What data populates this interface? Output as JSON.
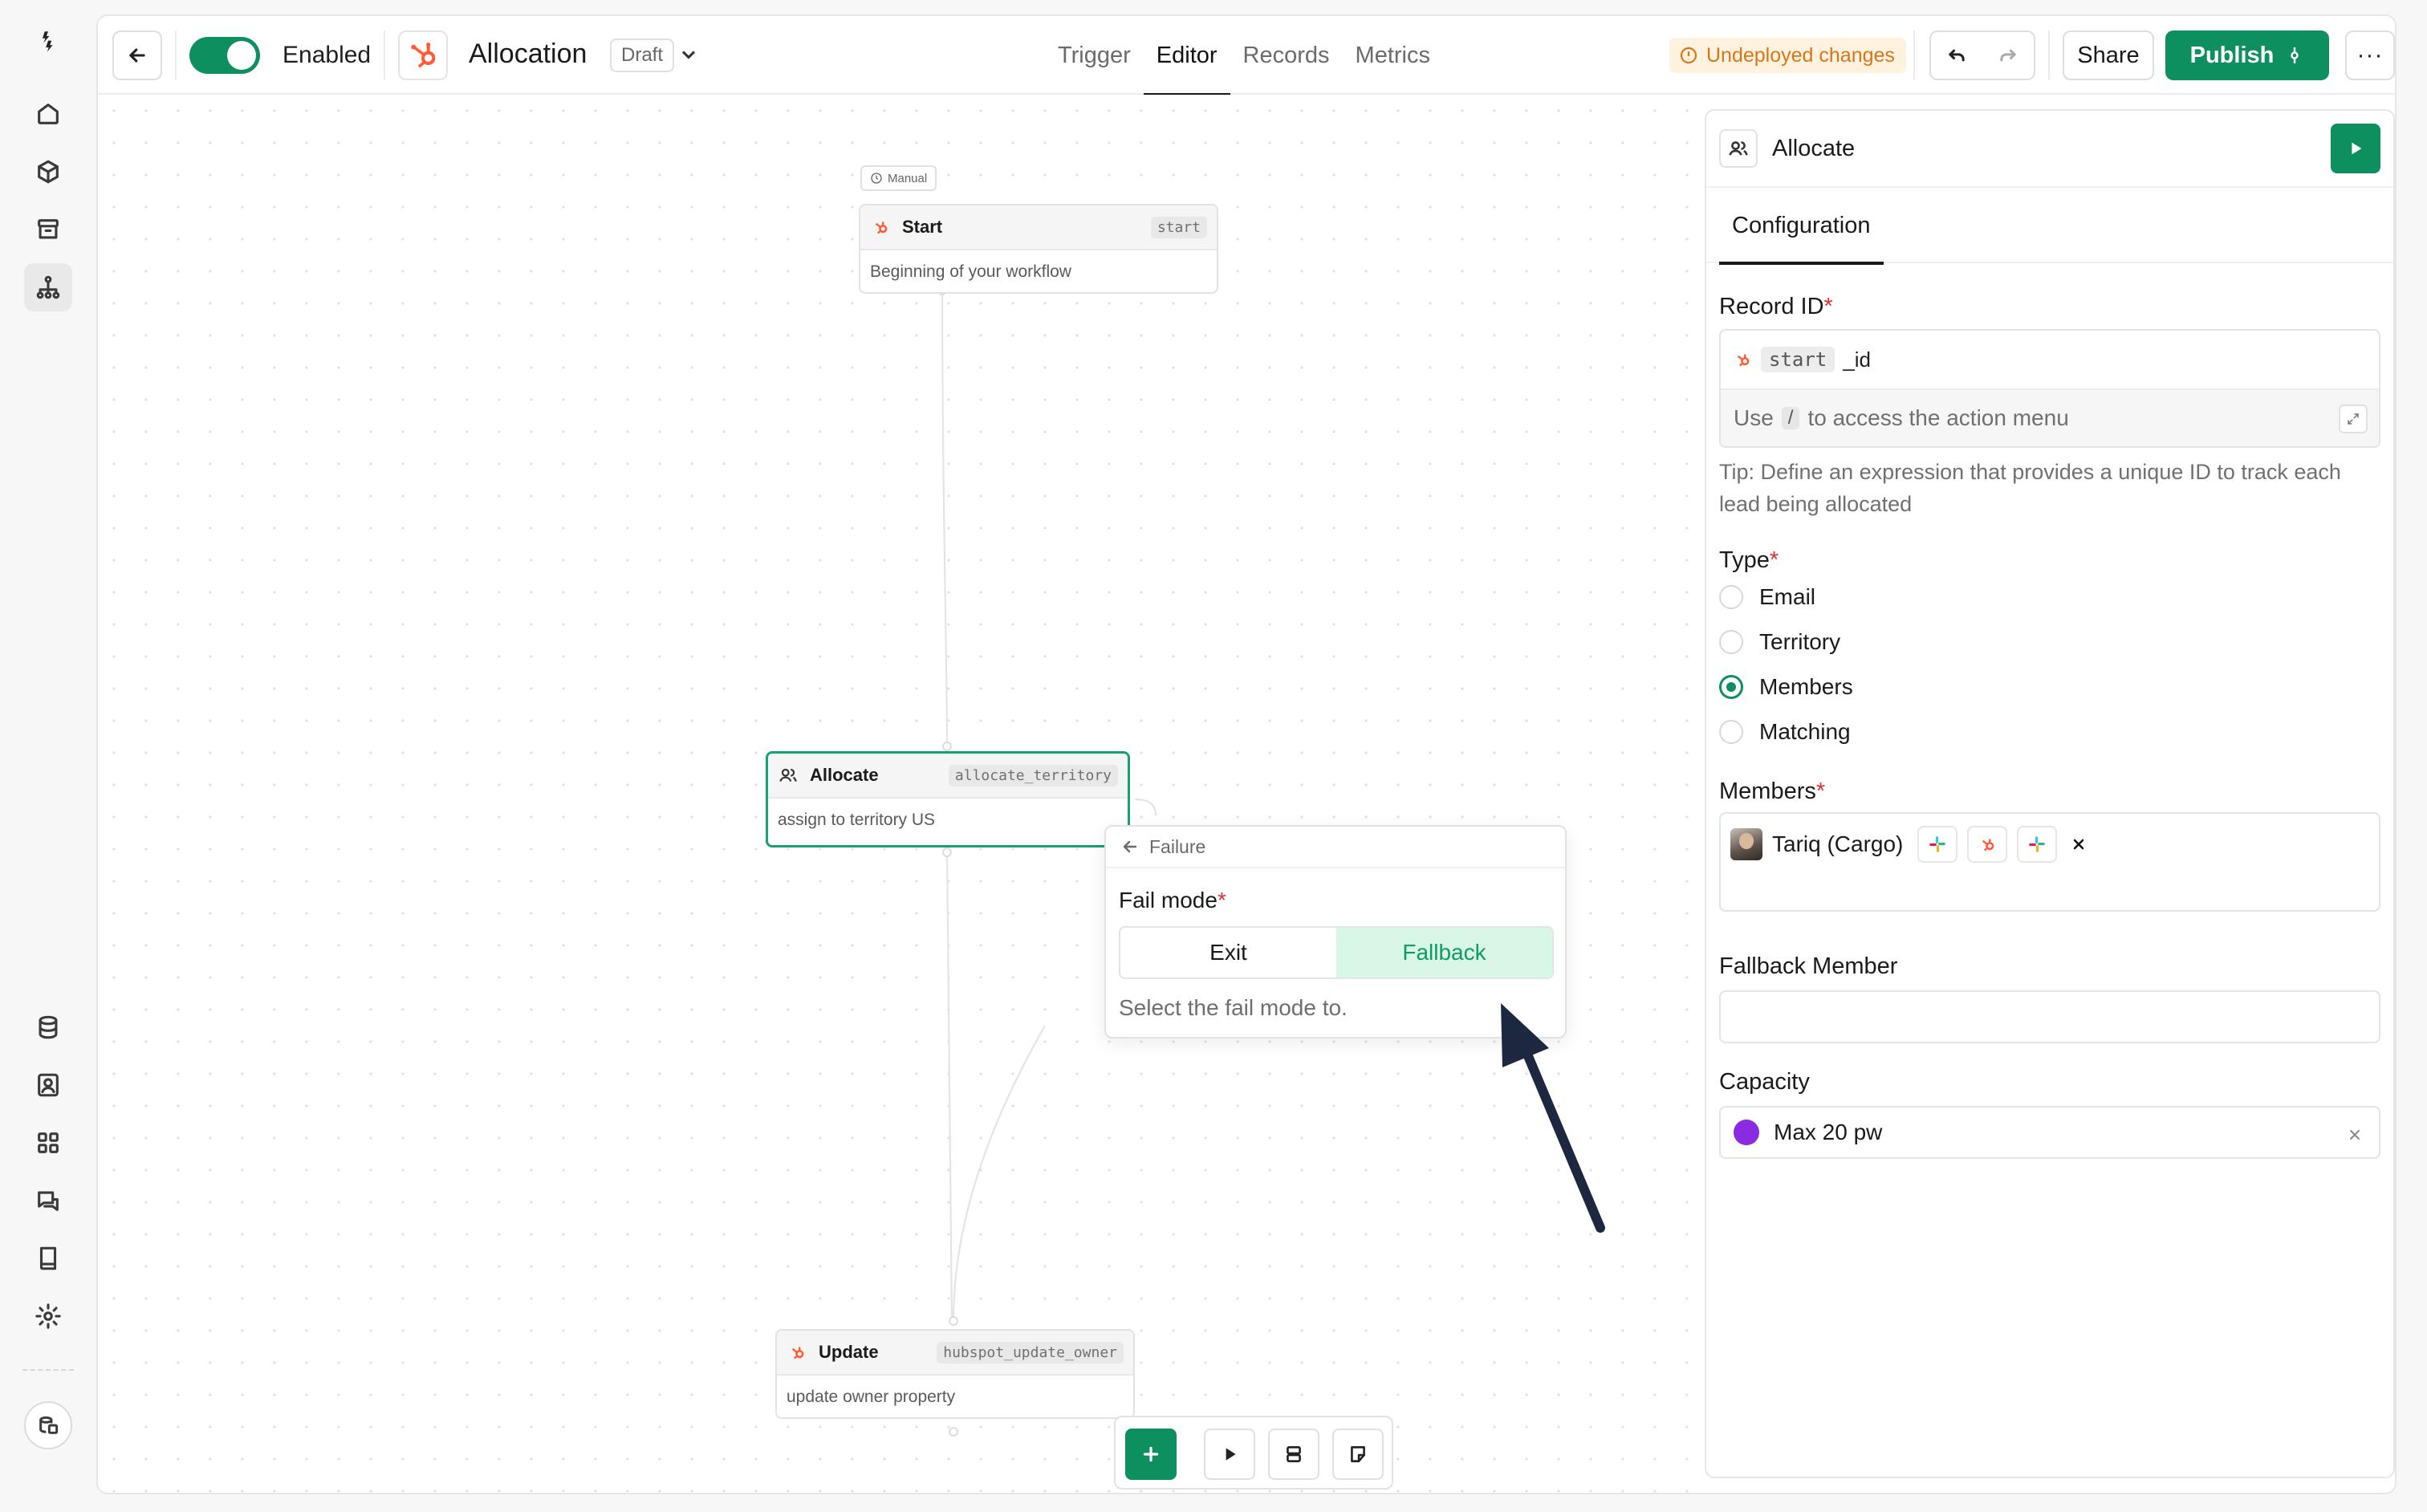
{
  "header": {
    "toggle_label": "Enabled",
    "workflow_title": "Allocation",
    "draft_badge": "Draft",
    "tabs": [
      {
        "label": "Trigger"
      },
      {
        "label": "Editor"
      },
      {
        "label": "Records"
      },
      {
        "label": "Metrics"
      }
    ],
    "active_tab": "Editor",
    "undeployed_label": "Undeployed changes",
    "share_label": "Share",
    "publish_label": "Publish",
    "more_label": "···"
  },
  "canvas": {
    "trigger_badge": "Manual",
    "nodes": [
      {
        "title": "Start",
        "tag": "start",
        "description": "Beginning of your workflow"
      },
      {
        "title": "Allocate",
        "tag": "allocate_territory",
        "description": "assign to territory US"
      },
      {
        "title": "Update",
        "tag": "hubspot_update_owner",
        "description": "update owner property"
      }
    ],
    "popover": {
      "back_label": "Failure",
      "field_label": "Fail mode",
      "options": [
        "Exit",
        "Fallback"
      ],
      "selected": "Fallback",
      "help": "Select the fail mode to."
    }
  },
  "panel": {
    "title": "Allocate",
    "tab": "Configuration",
    "record_id": {
      "label": "Record ID",
      "chip": "start",
      "suffix": "_id",
      "hint_before": "Use",
      "hint_key": "/",
      "hint_after": "to access the action menu",
      "tip": "Tip: Define an expression that provides a unique ID to track each lead being allocated"
    },
    "type": {
      "label": "Type",
      "options": [
        "Email",
        "Territory",
        "Members",
        "Matching"
      ],
      "selected": "Members"
    },
    "members": {
      "label": "Members",
      "member_name": "Tariq (Cargo)"
    },
    "fallback_member": {
      "label": "Fallback Member",
      "value": ""
    },
    "capacity": {
      "label": "Capacity",
      "value": "Max 20 pw"
    }
  },
  "colors": {
    "accent": "#0e8f5f",
    "warning": "#d9761a",
    "hubspot": "#ff5c35",
    "capacity_dot": "#8a2be2"
  }
}
